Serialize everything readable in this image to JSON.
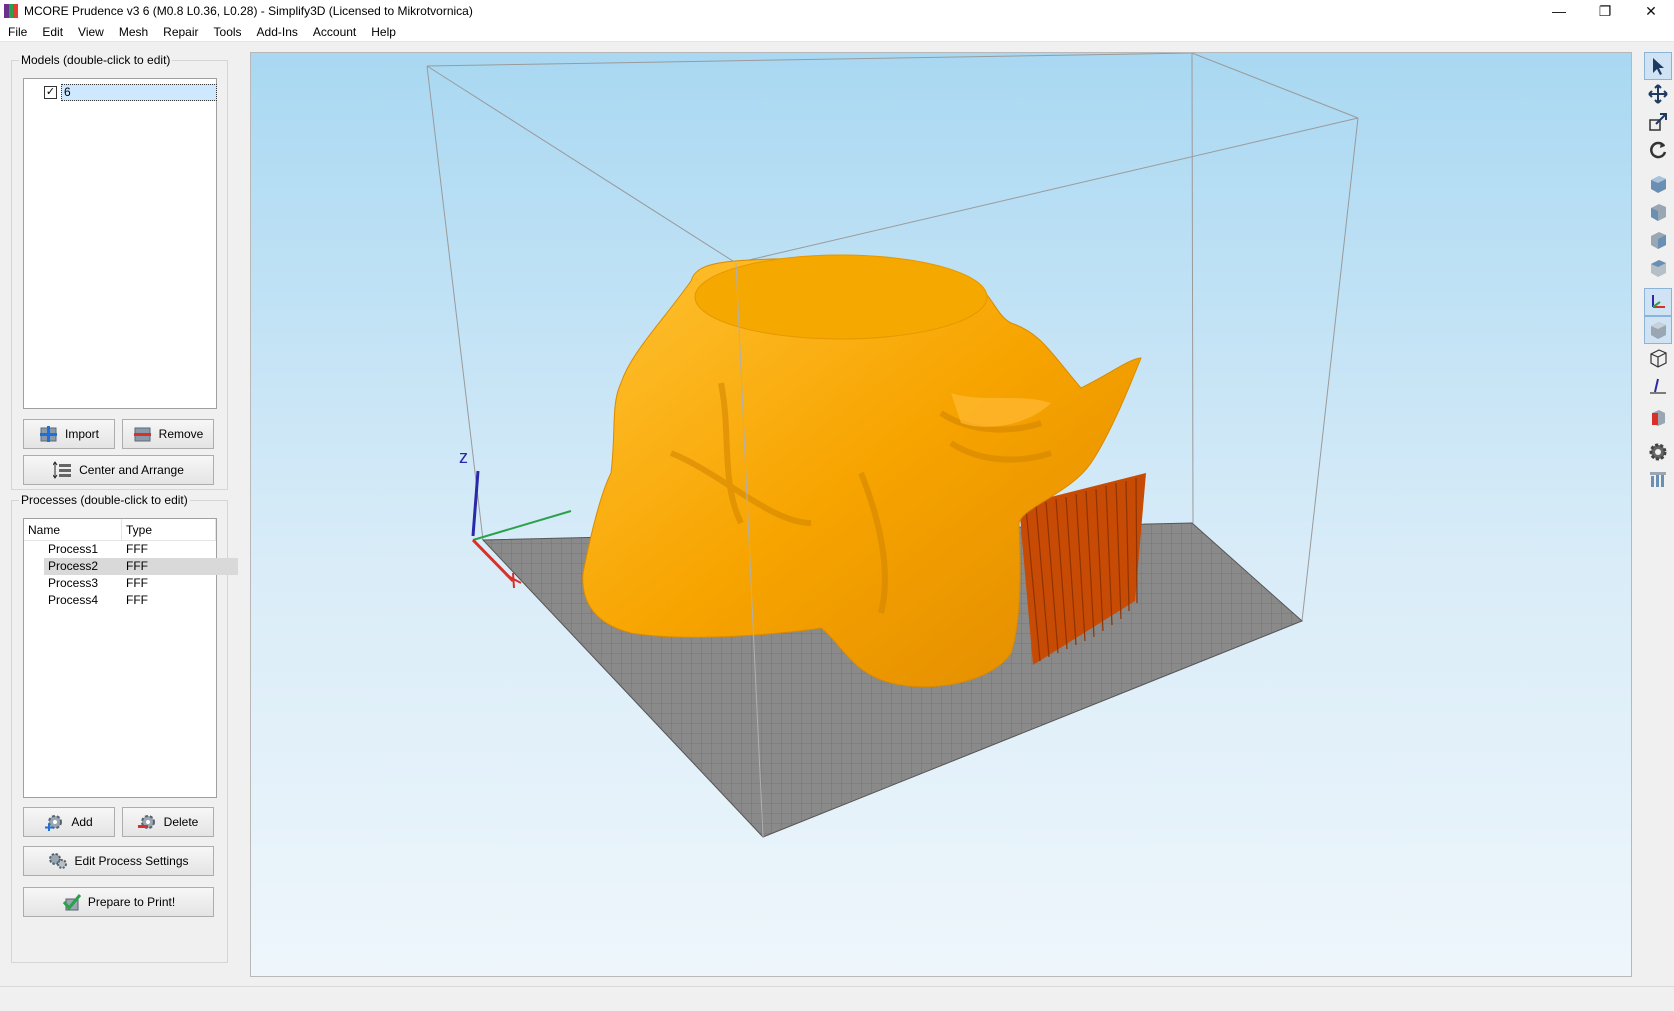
{
  "window": {
    "title": "MCORE Prudence v3 6 (M0.8 L0.36, L0.28) - Simplify3D (Licensed to Mikrotvornica)",
    "minimize_glyph": "—",
    "restore_glyph": "❐",
    "close_glyph": "✕"
  },
  "menu": {
    "items": [
      "File",
      "Edit",
      "View",
      "Mesh",
      "Repair",
      "Tools",
      "Add-Ins",
      "Account",
      "Help"
    ]
  },
  "models": {
    "group_title": "Models (double-click to edit)",
    "items": [
      {
        "label": "6",
        "checked": true
      }
    ],
    "check_glyph": "✓",
    "import_label": "Import",
    "remove_label": "Remove",
    "center_label": "Center and Arrange"
  },
  "processes": {
    "group_title": "Processes (double-click to edit)",
    "columns": [
      "Name",
      "Type"
    ],
    "rows": [
      {
        "name": "Process1",
        "type": "FFF"
      },
      {
        "name": "Process2",
        "type": "FFF"
      },
      {
        "name": "Process3",
        "type": "FFF"
      },
      {
        "name": "Process4",
        "type": "FFF"
      }
    ],
    "selected_row": 1,
    "add_label": "Add",
    "delete_label": "Delete",
    "edit_label": "Edit Process Settings",
    "prepare_label": "Prepare to Print!"
  },
  "viewport": {
    "axis_z_label": "z",
    "model_color": "#f7a400",
    "support_color": "#c74b05",
    "bed_color": "#8a8a8a"
  },
  "toolbar": {
    "tools": [
      "select-icon",
      "move-icon",
      "scale-icon",
      "rotate-icon",
      "view-default-icon",
      "view-front-icon",
      "view-side-icon",
      "view-top-icon",
      "axes-toggle-icon",
      "solid-view-icon",
      "wireframe-view-icon",
      "bed-axes-icon",
      "cross-section-icon",
      "settings-gear-icon",
      "supports-icon"
    ]
  },
  "colors": {
    "accent": "#0078d7",
    "selection": "#cde8ff"
  }
}
